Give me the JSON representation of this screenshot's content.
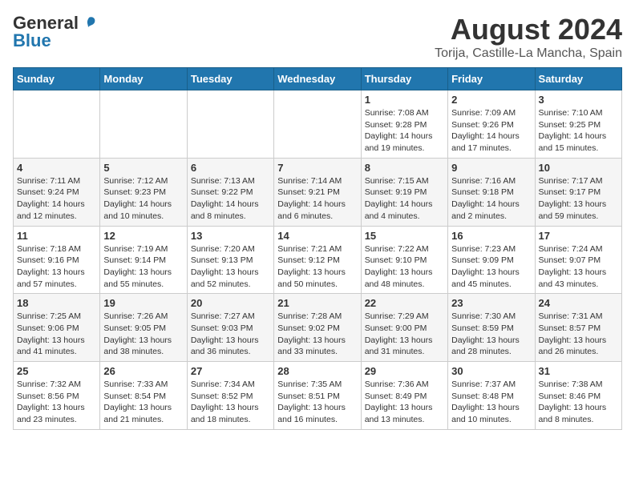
{
  "header": {
    "logo_general": "General",
    "logo_blue": "Blue",
    "title": "August 2024",
    "subtitle": "Torija, Castille-La Mancha, Spain"
  },
  "weekdays": [
    "Sunday",
    "Monday",
    "Tuesday",
    "Wednesday",
    "Thursday",
    "Friday",
    "Saturday"
  ],
  "weeks": [
    [
      {
        "day": "",
        "info": ""
      },
      {
        "day": "",
        "info": ""
      },
      {
        "day": "",
        "info": ""
      },
      {
        "day": "",
        "info": ""
      },
      {
        "day": "1",
        "info": "Sunrise: 7:08 AM\nSunset: 9:28 PM\nDaylight: 14 hours\nand 19 minutes."
      },
      {
        "day": "2",
        "info": "Sunrise: 7:09 AM\nSunset: 9:26 PM\nDaylight: 14 hours\nand 17 minutes."
      },
      {
        "day": "3",
        "info": "Sunrise: 7:10 AM\nSunset: 9:25 PM\nDaylight: 14 hours\nand 15 minutes."
      }
    ],
    [
      {
        "day": "4",
        "info": "Sunrise: 7:11 AM\nSunset: 9:24 PM\nDaylight: 14 hours\nand 12 minutes."
      },
      {
        "day": "5",
        "info": "Sunrise: 7:12 AM\nSunset: 9:23 PM\nDaylight: 14 hours\nand 10 minutes."
      },
      {
        "day": "6",
        "info": "Sunrise: 7:13 AM\nSunset: 9:22 PM\nDaylight: 14 hours\nand 8 minutes."
      },
      {
        "day": "7",
        "info": "Sunrise: 7:14 AM\nSunset: 9:21 PM\nDaylight: 14 hours\nand 6 minutes."
      },
      {
        "day": "8",
        "info": "Sunrise: 7:15 AM\nSunset: 9:19 PM\nDaylight: 14 hours\nand 4 minutes."
      },
      {
        "day": "9",
        "info": "Sunrise: 7:16 AM\nSunset: 9:18 PM\nDaylight: 14 hours\nand 2 minutes."
      },
      {
        "day": "10",
        "info": "Sunrise: 7:17 AM\nSunset: 9:17 PM\nDaylight: 13 hours\nand 59 minutes."
      }
    ],
    [
      {
        "day": "11",
        "info": "Sunrise: 7:18 AM\nSunset: 9:16 PM\nDaylight: 13 hours\nand 57 minutes."
      },
      {
        "day": "12",
        "info": "Sunrise: 7:19 AM\nSunset: 9:14 PM\nDaylight: 13 hours\nand 55 minutes."
      },
      {
        "day": "13",
        "info": "Sunrise: 7:20 AM\nSunset: 9:13 PM\nDaylight: 13 hours\nand 52 minutes."
      },
      {
        "day": "14",
        "info": "Sunrise: 7:21 AM\nSunset: 9:12 PM\nDaylight: 13 hours\nand 50 minutes."
      },
      {
        "day": "15",
        "info": "Sunrise: 7:22 AM\nSunset: 9:10 PM\nDaylight: 13 hours\nand 48 minutes."
      },
      {
        "day": "16",
        "info": "Sunrise: 7:23 AM\nSunset: 9:09 PM\nDaylight: 13 hours\nand 45 minutes."
      },
      {
        "day": "17",
        "info": "Sunrise: 7:24 AM\nSunset: 9:07 PM\nDaylight: 13 hours\nand 43 minutes."
      }
    ],
    [
      {
        "day": "18",
        "info": "Sunrise: 7:25 AM\nSunset: 9:06 PM\nDaylight: 13 hours\nand 41 minutes."
      },
      {
        "day": "19",
        "info": "Sunrise: 7:26 AM\nSunset: 9:05 PM\nDaylight: 13 hours\nand 38 minutes."
      },
      {
        "day": "20",
        "info": "Sunrise: 7:27 AM\nSunset: 9:03 PM\nDaylight: 13 hours\nand 36 minutes."
      },
      {
        "day": "21",
        "info": "Sunrise: 7:28 AM\nSunset: 9:02 PM\nDaylight: 13 hours\nand 33 minutes."
      },
      {
        "day": "22",
        "info": "Sunrise: 7:29 AM\nSunset: 9:00 PM\nDaylight: 13 hours\nand 31 minutes."
      },
      {
        "day": "23",
        "info": "Sunrise: 7:30 AM\nSunset: 8:59 PM\nDaylight: 13 hours\nand 28 minutes."
      },
      {
        "day": "24",
        "info": "Sunrise: 7:31 AM\nSunset: 8:57 PM\nDaylight: 13 hours\nand 26 minutes."
      }
    ],
    [
      {
        "day": "25",
        "info": "Sunrise: 7:32 AM\nSunset: 8:56 PM\nDaylight: 13 hours\nand 23 minutes."
      },
      {
        "day": "26",
        "info": "Sunrise: 7:33 AM\nSunset: 8:54 PM\nDaylight: 13 hours\nand 21 minutes."
      },
      {
        "day": "27",
        "info": "Sunrise: 7:34 AM\nSunset: 8:52 PM\nDaylight: 13 hours\nand 18 minutes."
      },
      {
        "day": "28",
        "info": "Sunrise: 7:35 AM\nSunset: 8:51 PM\nDaylight: 13 hours\nand 16 minutes."
      },
      {
        "day": "29",
        "info": "Sunrise: 7:36 AM\nSunset: 8:49 PM\nDaylight: 13 hours\nand 13 minutes."
      },
      {
        "day": "30",
        "info": "Sunrise: 7:37 AM\nSunset: 8:48 PM\nDaylight: 13 hours\nand 10 minutes."
      },
      {
        "day": "31",
        "info": "Sunrise: 7:38 AM\nSunset: 8:46 PM\nDaylight: 13 hours\nand 8 minutes."
      }
    ]
  ]
}
